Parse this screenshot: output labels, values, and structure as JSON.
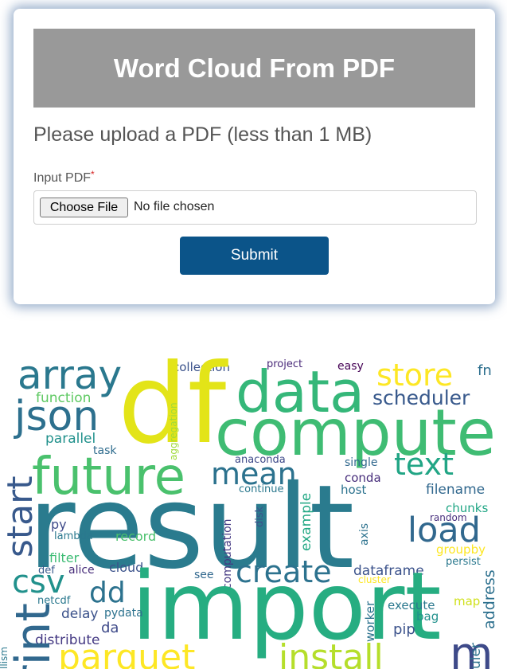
{
  "header": {
    "title": "Word Cloud From PDF"
  },
  "form": {
    "instruction": "Please upload a PDF (less than 1 MB)",
    "input_label": "Input PDF",
    "required_marker": "*",
    "choose_file_label": "Choose File",
    "file_status": "No file chosen",
    "submit_label": "Submit"
  },
  "colors": {
    "banner_bg": "#999999",
    "submit_bg": "#0b5489",
    "required": "#d62222"
  },
  "word_cloud": {
    "words": [
      {
        "text": "array",
        "color": "#2a788e"
      },
      {
        "text": "collection",
        "color": "#3b528b"
      },
      {
        "text": "project",
        "color": "#482878"
      },
      {
        "text": "easy",
        "color": "#440154"
      },
      {
        "text": "fn",
        "color": "#2d6f8e"
      },
      {
        "text": "df",
        "color": "#e3e418"
      },
      {
        "text": "data",
        "color": "#35b779"
      },
      {
        "text": "store",
        "color": "#fde725"
      },
      {
        "text": "scheduler",
        "color": "#38598c"
      },
      {
        "text": "json",
        "color": "#2d708e"
      },
      {
        "text": "function",
        "color": "#5ec962"
      },
      {
        "text": "compute",
        "color": "#3fbc73"
      },
      {
        "text": "parallel",
        "color": "#21918c"
      },
      {
        "text": "task",
        "color": "#2f6c8e"
      },
      {
        "text": "aggregation",
        "color": "#a0da39"
      },
      {
        "text": "text",
        "color": "#21a585"
      },
      {
        "text": "future",
        "color": "#4ac16d"
      },
      {
        "text": "anaconda",
        "color": "#3e4989"
      },
      {
        "text": "single",
        "color": "#31688e"
      },
      {
        "text": "mean",
        "color": "#2c728e"
      },
      {
        "text": "conda",
        "color": "#472d7b"
      },
      {
        "text": "host",
        "color": "#2c728e"
      },
      {
        "text": "filename",
        "color": "#31688e"
      },
      {
        "text": "continue",
        "color": "#2a788e"
      },
      {
        "text": "start",
        "color": "#38598c"
      },
      {
        "text": "result",
        "color": "#2a7b8e"
      },
      {
        "text": "chunks",
        "color": "#21a685"
      },
      {
        "text": "py",
        "color": "#3e4a89"
      },
      {
        "text": "lambda",
        "color": "#2a788e"
      },
      {
        "text": "record",
        "color": "#4ac16d"
      },
      {
        "text": "disk",
        "color": "#3b528b"
      },
      {
        "text": "computation",
        "color": "#443983"
      },
      {
        "text": "example",
        "color": "#22a884"
      },
      {
        "text": "axis",
        "color": "#2c728e"
      },
      {
        "text": "load",
        "color": "#31688e"
      },
      {
        "text": "random",
        "color": "#472f7d"
      },
      {
        "text": "groupby",
        "color": "#fde725"
      },
      {
        "text": "filter",
        "color": "#3dbc74"
      },
      {
        "text": "persist",
        "color": "#2a788e"
      },
      {
        "text": "def",
        "color": "#38598c"
      },
      {
        "text": "alice",
        "color": "#472c7a"
      },
      {
        "text": "cloud",
        "color": "#3b528b"
      },
      {
        "text": "create",
        "color": "#2c728e"
      },
      {
        "text": "csv",
        "color": "#21918c"
      },
      {
        "text": "see",
        "color": "#31688e"
      },
      {
        "text": "dataframe",
        "color": "#3b528b"
      },
      {
        "text": "cluster",
        "color": "#fde725"
      },
      {
        "text": "dd",
        "color": "#2c728e"
      },
      {
        "text": "import",
        "color": "#26ad81"
      },
      {
        "text": "map",
        "color": "#d0e11c"
      },
      {
        "text": "netcdf",
        "color": "#2a788e"
      },
      {
        "text": "delay",
        "color": "#3b528b"
      },
      {
        "text": "pydata",
        "color": "#2c728e"
      },
      {
        "text": "execute",
        "color": "#2a788e"
      },
      {
        "text": "bag",
        "color": "#21918c"
      },
      {
        "text": "worker",
        "color": "#2c728e"
      },
      {
        "text": "address",
        "color": "#2d708e"
      },
      {
        "text": "da",
        "color": "#3e4a89"
      },
      {
        "text": "pip",
        "color": "#3b528b"
      },
      {
        "text": "distribute",
        "color": "#443983"
      },
      {
        "text": "parquet",
        "color": "#fde725"
      },
      {
        "text": "install",
        "color": "#b5de2b"
      },
      {
        "text": "rint",
        "color": "#31688e"
      },
      {
        "text": "m",
        "color": "#3e4a89"
      },
      {
        "text": "uler",
        "color": "#2c728e"
      },
      {
        "text": "llism",
        "color": "#2a788e"
      }
    ]
  }
}
